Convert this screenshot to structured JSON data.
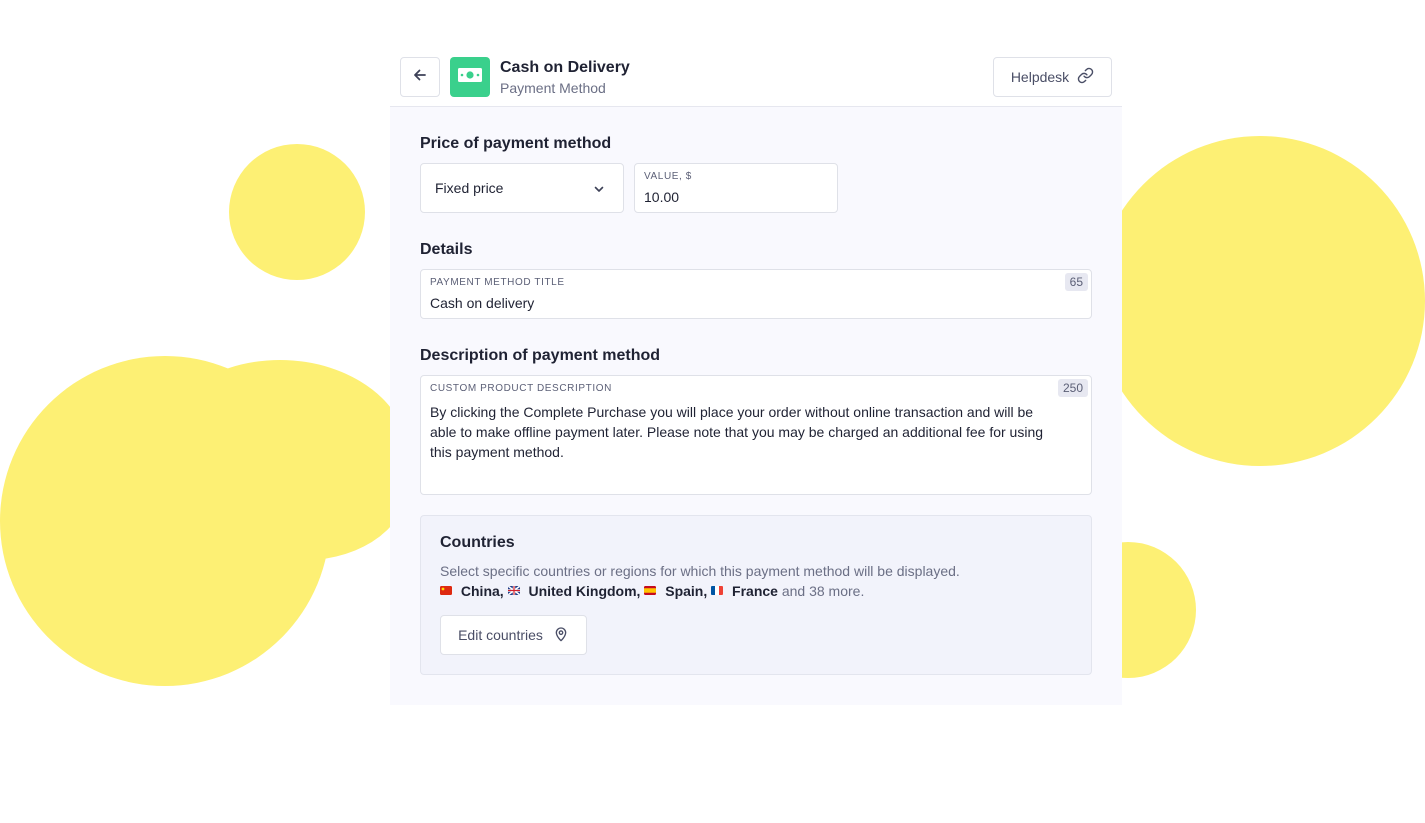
{
  "colors": {
    "accent_yellow": "#fdf074",
    "app_icon_green": "#3ad08c",
    "panel_bg": "#f9f9fe",
    "countries_card_bg": "#f2f3fb"
  },
  "header": {
    "back_icon": "arrow-left-icon",
    "app_icon": "banknote-icon",
    "title": "Cash on Delivery",
    "subtitle": "Payment Method",
    "helpdesk_label": "Helpdesk",
    "helpdesk_icon": "link-icon"
  },
  "price": {
    "section_title": "Price of payment method",
    "price_type": "Fixed price",
    "value_label": "Value, $",
    "value": "10.00"
  },
  "details": {
    "section_title": "Details",
    "title_label": "Payment method title",
    "title_value": "Cash on delivery",
    "title_counter": "65"
  },
  "description": {
    "section_title": "Description of payment method",
    "label": "Custom product description",
    "counter": "250",
    "text": "By clicking the Complete Purchase you will place your order without online transaction and will be able to make offline payment later. Please note that you may be charged an additional fee for using this payment method."
  },
  "countries": {
    "title": "Countries",
    "help_text": "Select specific countries or regions for which this payment method will be displayed.",
    "items": [
      {
        "name": "China,",
        "flag_icon": "flag-china-icon"
      },
      {
        "name": "United Kingdom,",
        "flag_icon": "flag-uk-icon"
      },
      {
        "name": "Spain,",
        "flag_icon": "flag-spain-icon"
      },
      {
        "name": "France",
        "flag_icon": "flag-france-icon"
      }
    ],
    "more_text": "and 38 more.",
    "edit_button_label": "Edit countries",
    "edit_button_icon": "map-pin-icon"
  }
}
